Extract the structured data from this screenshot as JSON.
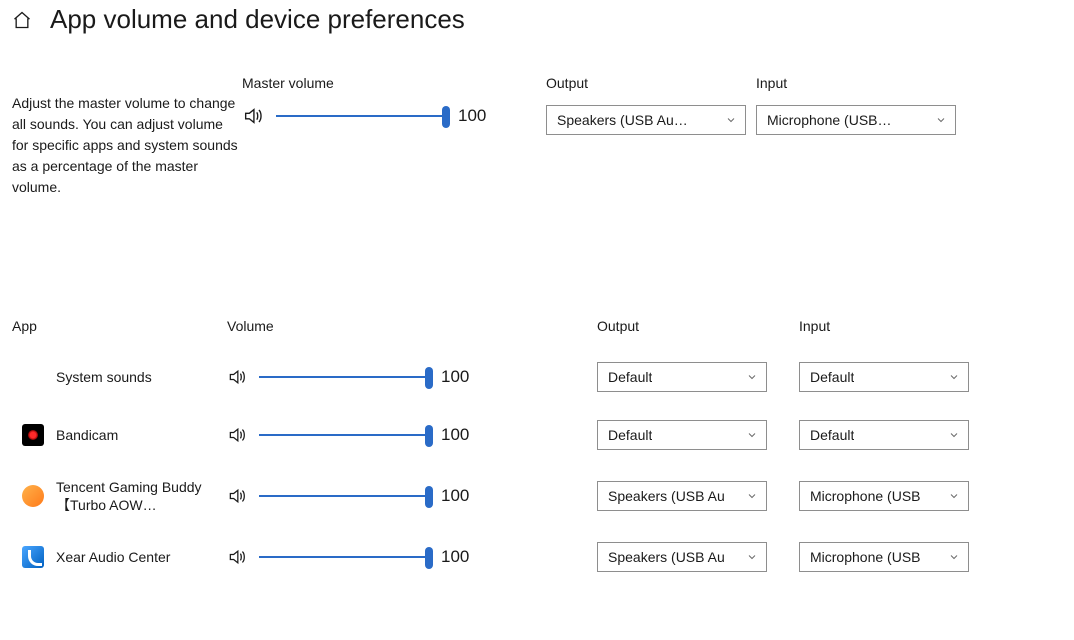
{
  "header": {
    "title": "App volume and device preferences"
  },
  "master": {
    "desc": "Adjust the master volume to change all sounds. You can adjust volume for specific apps and system sounds as a percentage of the master volume.",
    "volume_label": "Master volume",
    "output_label": "Output",
    "input_label": "Input",
    "volume": "100",
    "output_selected": "Speakers (USB Au…",
    "input_selected": "Microphone (USB…"
  },
  "apps_header": {
    "app": "App",
    "volume": "Volume",
    "output": "Output",
    "input": "Input"
  },
  "apps": [
    {
      "icon": "none",
      "name": "System sounds",
      "volume": "100",
      "output": "Default",
      "input": "Default"
    },
    {
      "icon": "bandicam",
      "name": "Bandicam",
      "volume": "100",
      "output": "Default",
      "input": "Default"
    },
    {
      "icon": "tencent",
      "name": "Tencent Gaming Buddy【Turbo AOW…",
      "volume": "100",
      "output": "Speakers (USB Au",
      "input": "Microphone (USB"
    },
    {
      "icon": "xear",
      "name": "Xear Audio Center",
      "volume": "100",
      "output": "Speakers (USB Au",
      "input": "Microphone (USB"
    }
  ]
}
